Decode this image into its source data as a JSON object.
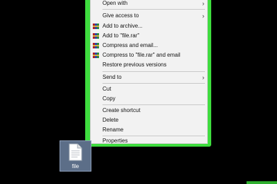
{
  "context_menu": {
    "items": [
      {
        "label": "Open with"
      },
      {
        "label": "Give access to"
      },
      {
        "label": "Add to archive..."
      },
      {
        "label": "Add to \"file.rar\""
      },
      {
        "label": "Compress and email..."
      },
      {
        "label": "Compress to \"file.rar\" and email"
      },
      {
        "label": "Restore previous versions"
      },
      {
        "label": "Send to"
      },
      {
        "label": "Cut"
      },
      {
        "label": "Copy"
      },
      {
        "label": "Create shortcut"
      },
      {
        "label": "Delete"
      },
      {
        "label": "Rename"
      },
      {
        "label": "Properties"
      }
    ],
    "submenu_icon": "chevron-right-icon",
    "archive_icon": "winrar-books-icon"
  },
  "desktop_file": {
    "label": "file",
    "icon": "document-file-icon"
  },
  "colors": {
    "highlight_frame": "#3edc3e",
    "menu_background": "#f2f2f2",
    "file_selection": "#5c6e88"
  }
}
